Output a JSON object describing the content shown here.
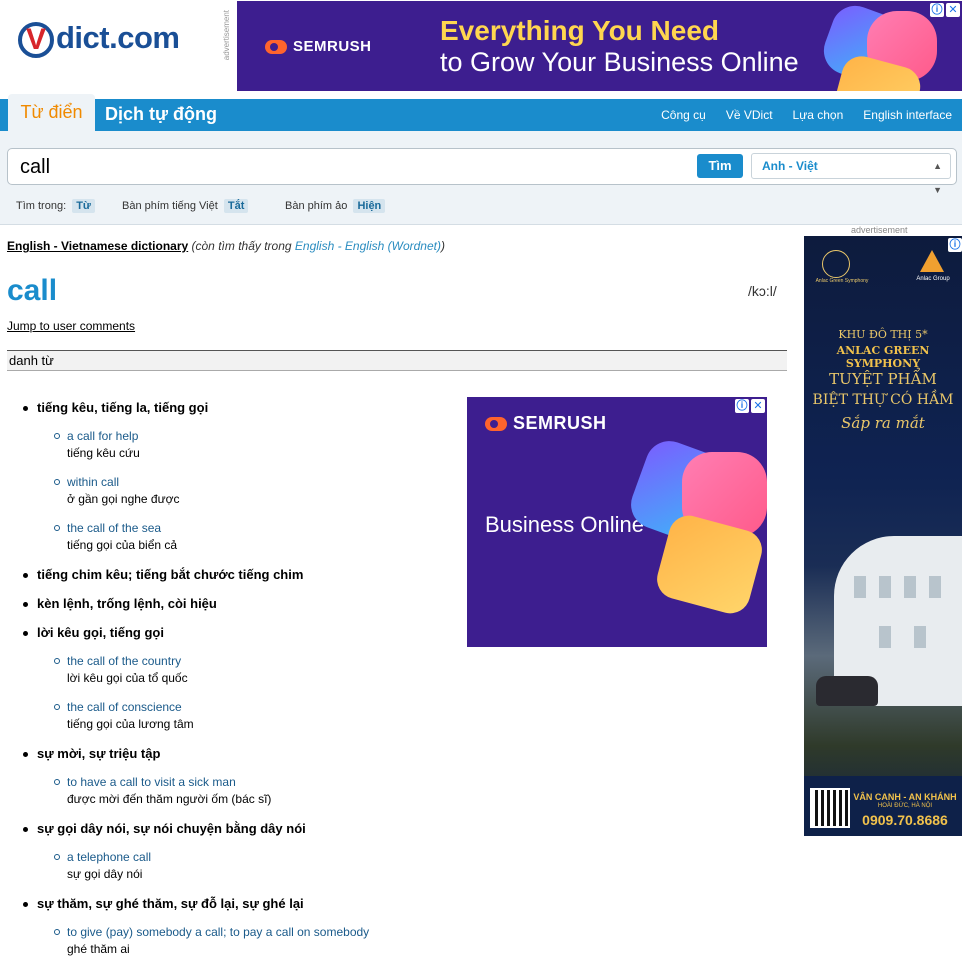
{
  "header": {
    "logo": "Vdict.com",
    "logo_v": "V",
    "logo_rest": "dict.com",
    "ad_vertical_label": "advertisement",
    "top_ad": {
      "brand": "SEMRUSH",
      "headline1": "Everything You Need",
      "headline2": "to Grow Your Business Online"
    }
  },
  "nav": {
    "tab_dictionary": "Từ điển",
    "tab_auto_translate": "Dịch tự động",
    "links": [
      "Công cụ",
      "Về VDict",
      "Lựa chọn",
      "English interface"
    ]
  },
  "search": {
    "query": "call",
    "button": "Tìm",
    "language": "Anh - Việt",
    "options": [
      {
        "label": "Tìm trong:",
        "value": "Từ"
      },
      {
        "label": "Bàn phím tiếng Việt",
        "value": "Tắt"
      },
      {
        "label": "Bàn phím ảo",
        "value": "Hiện"
      }
    ]
  },
  "content": {
    "dictionary_link": "English - Vietnamese dictionary",
    "also_found_prefix": "(còn tìm thấy trong ",
    "also_found_link": "English - English (Wordnet)",
    "also_found_suffix": ")",
    "word": "call",
    "pronunciation": "/kɔ:l/",
    "jump_link": "Jump to user comments",
    "part_of_speech": "danh từ",
    "senses": [
      {
        "text": "tiếng kêu, tiếng la, tiếng gọi",
        "examples": [
          {
            "en": "a call for help",
            "vi": "tiếng kêu cứu"
          },
          {
            "en": "within call",
            "vi": "ở gần gọi nghe được"
          },
          {
            "en": "the call of the sea",
            "vi": "tiếng gọi của biển cả"
          }
        ]
      },
      {
        "text": "tiếng chim kêu; tiếng bắt chước tiếng chim",
        "examples": []
      },
      {
        "text": "kèn lệnh, trống lệnh, còi hiệu",
        "examples": []
      },
      {
        "text": "lời kêu gọi, tiếng gọi",
        "examples": [
          {
            "en": "the call of the country",
            "vi": "lời kêu gọi của tổ quốc"
          },
          {
            "en": "the call of conscience",
            "vi": "tiếng gọi của lương tâm"
          }
        ]
      },
      {
        "text": "sự mời, sự triệu tập",
        "examples": [
          {
            "en": "to have a call to visit a sick man",
            "vi": "được mời đến thăm người ốm (bác sĩ)"
          }
        ]
      },
      {
        "text": "sự gọi dây nói, sự nói chuyện bằng dây nói",
        "examples": [
          {
            "en": "a telephone call",
            "vi": "sự gọi dây nói"
          }
        ]
      },
      {
        "text": "sự thăm, sự ghé thăm, sự đỗ lại, sự ghé lại",
        "examples": [
          {
            "en": "to give (pay) somebody a call; to pay a call on somebody",
            "vi": "ghé thăm ai"
          }
        ]
      }
    ]
  },
  "ads": {
    "mid_brand": "SEMRUSH",
    "mid_text": "Business Online",
    "right_label": "advertisement",
    "right_ad": {
      "brand1": "Anlac Green Symphony",
      "brand2": "Anlac Group",
      "line1": "KHU ĐÔ THỊ 5*",
      "line2": "ANLAC GREEN SYMPHONY",
      "line3": "TUYỆT PHẨM",
      "line4": "BIỆT THỰ CÓ HẦM",
      "line5": "Sắp ra mắt",
      "location": "VÂN CANH - AN KHÁNH",
      "sublocation": "HOÀI ĐỨC, HÀ NỘI",
      "phone": "0909.70.8686"
    }
  },
  "colors": {
    "brand_blue": "#1a8ccc",
    "tab_orange": "#f08a00",
    "ad_purple": "#3d1e8f"
  }
}
